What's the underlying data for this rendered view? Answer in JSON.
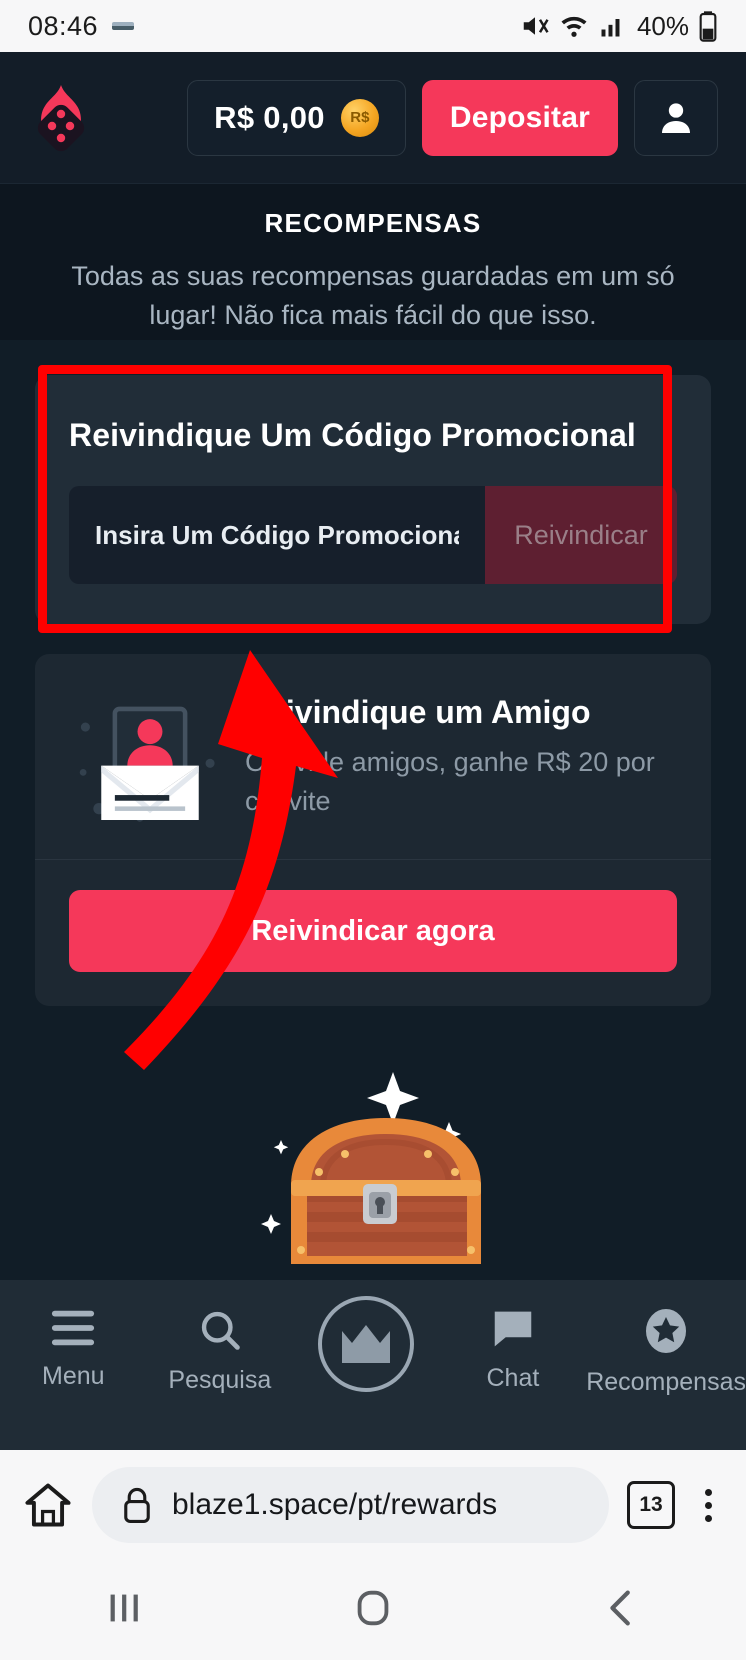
{
  "statusbar": {
    "time": "08:46",
    "battery": "40%",
    "icons": [
      "mute-icon",
      "wifi-icon",
      "signal-icon",
      "battery-icon"
    ]
  },
  "header": {
    "logo_name": "blaze-flame-logo",
    "balance": "R$ 0,00",
    "coin_label": "R$",
    "deposit_label": "Depositar",
    "avatar_name": "user-avatar-icon"
  },
  "intro": {
    "title": "RECOMPENSAS",
    "subtitle": "Todas as suas recompensas guardadas em um só lugar! Não fica mais fácil do que isso."
  },
  "promo": {
    "title": "Reivindique Um Código Promocional",
    "input_value": "",
    "input_placeholder": "Insira Um Código Promocional",
    "button_label": "Reivindicar"
  },
  "referral": {
    "title": "Reivindique um Amigo",
    "description": "Convide amigos, ganhe R$ 20 por convite",
    "button_label": "Reivindicar agora",
    "icon_name": "envelope-invite-icon"
  },
  "chest": {
    "icon_name": "treasure-chest-icon"
  },
  "bottom_nav": {
    "items": [
      {
        "label": "Menu",
        "icon": "hamburger-menu-icon"
      },
      {
        "label": "Pesquisa",
        "icon": "search-icon"
      },
      {
        "label": "",
        "icon": "crown-icon"
      },
      {
        "label": "Chat",
        "icon": "chat-bubble-icon"
      },
      {
        "label": "Recompensas",
        "icon": "star-badge-icon"
      }
    ]
  },
  "browser": {
    "home_icon": "home-icon",
    "lock_icon": "lock-icon",
    "url": "blaze1.space/pt/rewards",
    "tab_count": "13",
    "menu_icon": "kebab-menu-icon"
  },
  "android_nav": {
    "recents": "recents-icon",
    "home": "home-square-icon",
    "back": "back-chevron-icon"
  },
  "colors": {
    "accent_red": "#f5385a",
    "annotation_red": "#ff0000",
    "bg_dark": "#111d27",
    "card": "#212d38"
  }
}
